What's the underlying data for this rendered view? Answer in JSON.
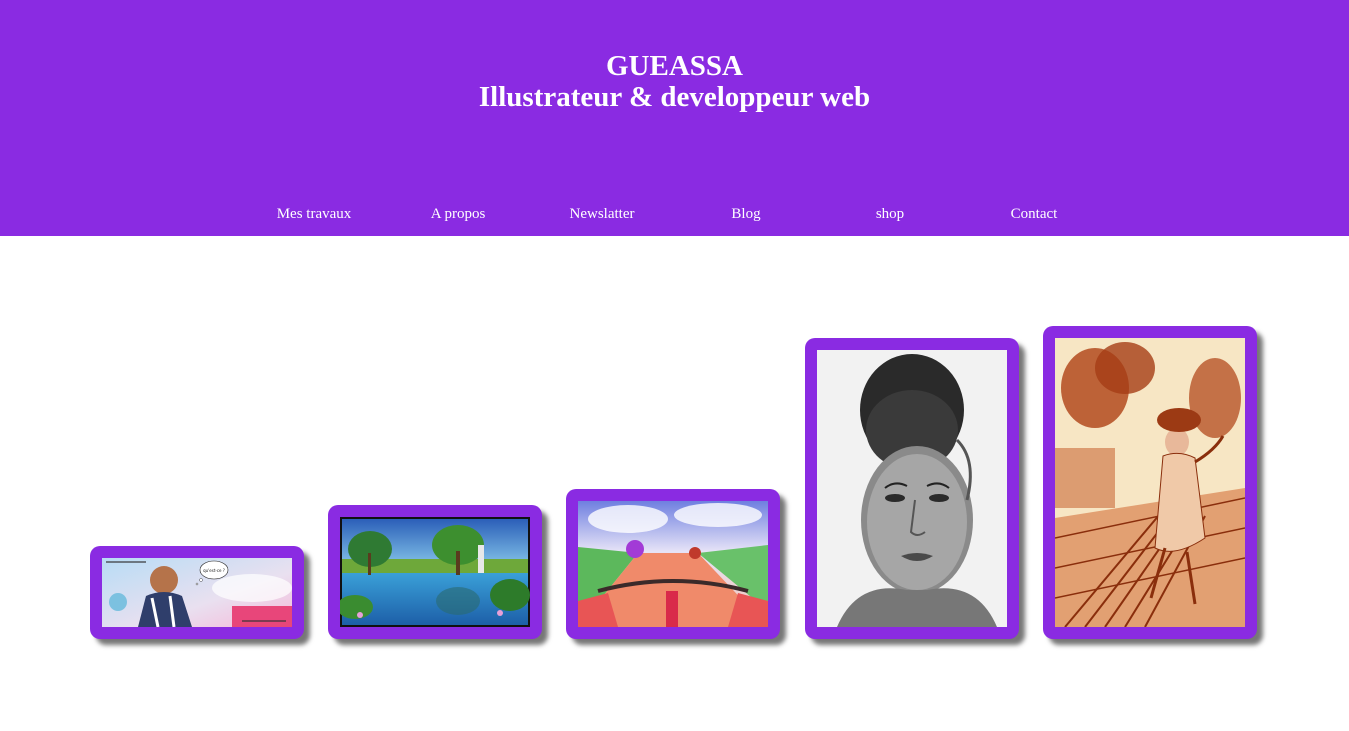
{
  "header": {
    "title": "GUEASSA",
    "subtitle": "Illustrateur & developpeur web",
    "background": "#8a2be2"
  },
  "nav": {
    "items": [
      "Mes travaux",
      "A propos",
      "Newslatter",
      "Blog",
      "shop",
      "Contact"
    ]
  },
  "gallery": {
    "artwork_1": {
      "speech_bubble": "qu'est-ce ?"
    }
  }
}
